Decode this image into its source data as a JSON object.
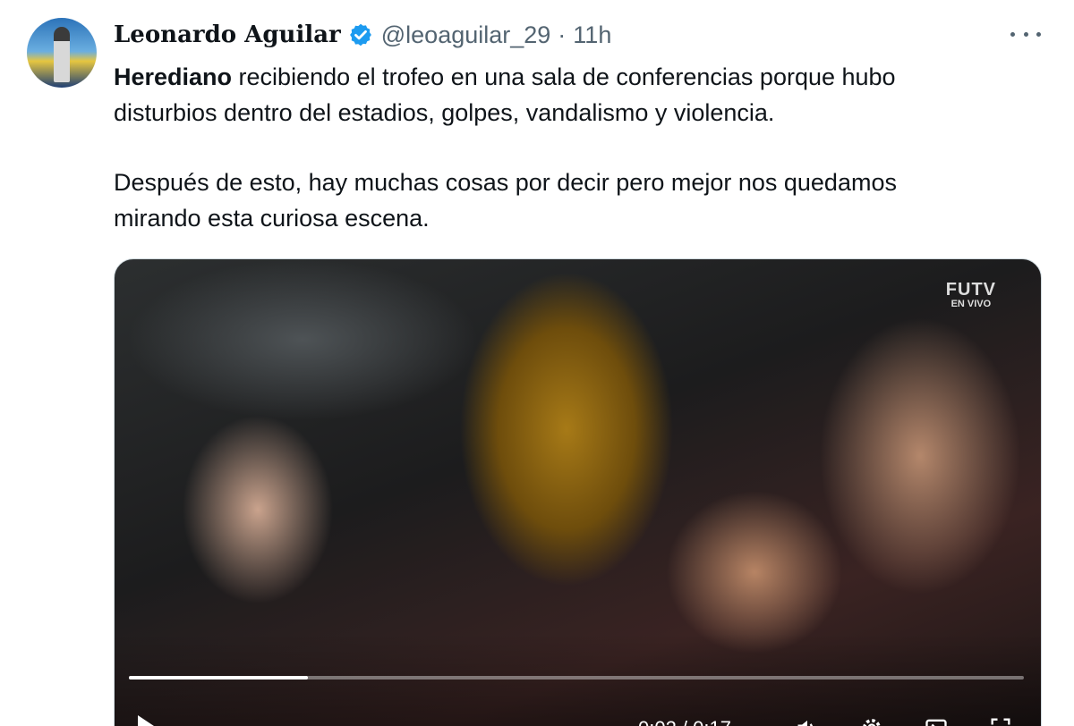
{
  "author": {
    "name": "Leonardo Aguilar",
    "handle": "@leoaguilar_29",
    "separator": "·",
    "time": "11h",
    "verified_color": "#1d9bf0"
  },
  "tweet": {
    "line1_bold": "Herediano",
    "line1_rest": " recibiendo el trofeo en una sala de conferencias porque hubo",
    "line2": "disturbios dentro del estadios, golpes, vandalismo y violencia.",
    "line3": "Después de esto, hay muchas cosas por decir pero mejor nos quedamos",
    "line4": "mirando esta curiosa escena."
  },
  "video": {
    "watermark_top": "FUTV",
    "watermark_bottom": "EN VIVO",
    "progress_fraction": 0.2,
    "timecode": "0:02 / 0:17",
    "controls": [
      "play-icon",
      "volume-icon",
      "settings-icon",
      "pip-icon",
      "fullscreen-icon"
    ]
  },
  "colors": {
    "text": "#0f1419",
    "secondary": "#536471",
    "accent": "#1d9bf0"
  }
}
